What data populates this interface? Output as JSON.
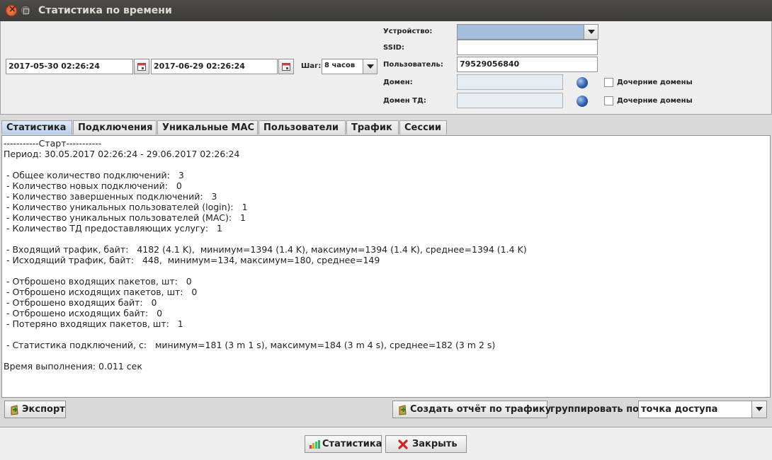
{
  "window": {
    "title": "Статистика по времени"
  },
  "filters": {
    "date_from": "2017-05-30 02:26:24",
    "date_to": "2017-06-29 02:26:24",
    "step_label": "Шаг:",
    "step_value": "8 часов",
    "device_label": "Устройство:",
    "device_value": "",
    "ssid_label": "SSID:",
    "ssid_value": "",
    "user_label": "Пользователь:",
    "user_value": "79529056840",
    "domain_label": "Домен:",
    "domain_value": "",
    "domain_td_label": "Домен ТД:",
    "domain_td_value": "",
    "child_domains_label": "Дочерние домены",
    "child_domains_td_label": "Дочерние домены"
  },
  "tabs": [
    {
      "label": "Статистика",
      "active": true
    },
    {
      "label": "Подключения"
    },
    {
      "label": "Уникальные MAC"
    },
    {
      "label": "Пользователи"
    },
    {
      "label": "Трафик"
    },
    {
      "label": "Сессии"
    }
  ],
  "report": {
    "lines": [
      "-----------Старт-----------",
      "Период: 30.05.2017 02:26:24 - 29.06.2017 02:26:24",
      "",
      " - Общее количество подключений:   3",
      " - Количество новых подключений:   0",
      " - Количество завершенных подключений:   3",
      " - Количество уникальных пользователей (login):   1",
      " - Количество уникальных пользователей (MAC):   1",
      " - Количество ТД предоставляющих услугу:   1",
      "",
      " - Входящий трафик, байт:   4182 (4.1 K),  минимум=1394 (1.4 K), максимум=1394 (1.4 K), среднее=1394 (1.4 K)",
      " - Исходящий трафик, байт:   448,  минимум=134, максимум=180, среднее=149",
      "",
      " - Отброшено входящих пакетов, шт:   0",
      " - Отброшено исходящих пакетов, шт:   0",
      " - Отброшено входящих байт:   0",
      " - Отброшено исходящих байт:   0",
      " - Потеряно входящих пакетов, шт:   1",
      "",
      " - Статистика подключений, с:   минимум=181 (3 m 1 s), максимум=184 (3 m 4 s), среднее=182 (3 m 2 s)",
      "",
      "Время выполнения: 0.011 сек"
    ]
  },
  "actions": {
    "export_label": "Экспорт",
    "traffic_report_label": "Создать отчёт по трафику",
    "group_by_label": "группировать по:",
    "group_by_value": "точка доступа"
  },
  "footer": {
    "statistics_label": "Статистика",
    "close_label": "Закрыть"
  }
}
